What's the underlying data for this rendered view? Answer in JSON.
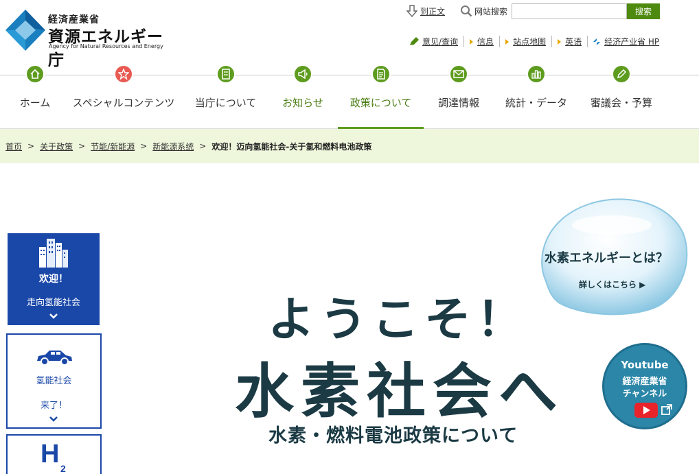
{
  "header": {
    "agency": "経済産業省",
    "name": "資源エネルギー庁",
    "name_en": "Agency for Natural Resources and Energy"
  },
  "util": {
    "jp_text_link": "到正文",
    "search_label": "网站搜索",
    "search_value": "",
    "search_button": "搜索",
    "links": [
      "意见/查询",
      "信息",
      "站点地图",
      "英语",
      "经济产业省 HP"
    ]
  },
  "nav": {
    "items": [
      {
        "label": "ホーム",
        "icon": "home-icon"
      },
      {
        "label": "スペシャルコンテンツ",
        "icon": "star-icon"
      },
      {
        "label": "当庁について",
        "icon": "building-icon"
      },
      {
        "label": "お知らせ",
        "icon": "megaphone-icon"
      },
      {
        "label": "政策について",
        "icon": "document-icon"
      },
      {
        "label": "調達情報",
        "icon": "envelope-icon"
      },
      {
        "label": "統計・データ",
        "icon": "bar-chart-icon"
      },
      {
        "label": "審議会・予算",
        "icon": "pencil-icon"
      }
    ],
    "active_index": 4,
    "accent_color": "#5e9c1f"
  },
  "breadcrumb": {
    "items": [
      "首页",
      "关于政策",
      "节能/新能源",
      "新能源系统"
    ],
    "separator": ">",
    "current": "欢迎！迈向氢能社会-关于氢和燃料电池政策"
  },
  "side": {
    "item1": {
      "line1": "欢迎！",
      "line2": "走向氢能社会"
    },
    "item2": {
      "line1": "氢能社会",
      "line2": "来了！"
    },
    "item3": {
      "symbol": "H",
      "subscript": "2"
    }
  },
  "hero": {
    "line1": "ようこそ！",
    "line2": "水素社会へ",
    "line3": "水素・燃料電池政策について"
  },
  "bubble": {
    "title": "水素エネルギーとは？",
    "link": "詳しくはこちら ▶"
  },
  "youtube": {
    "line1": "Youtube",
    "line2": "経済産業省",
    "line3": "チャンネル"
  },
  "colors": {
    "brand_blue": "#1a48a8",
    "nav_green": "#5e9c1f",
    "crumb_bg": "#eef6dc",
    "hero_text": "#1b3a44"
  }
}
